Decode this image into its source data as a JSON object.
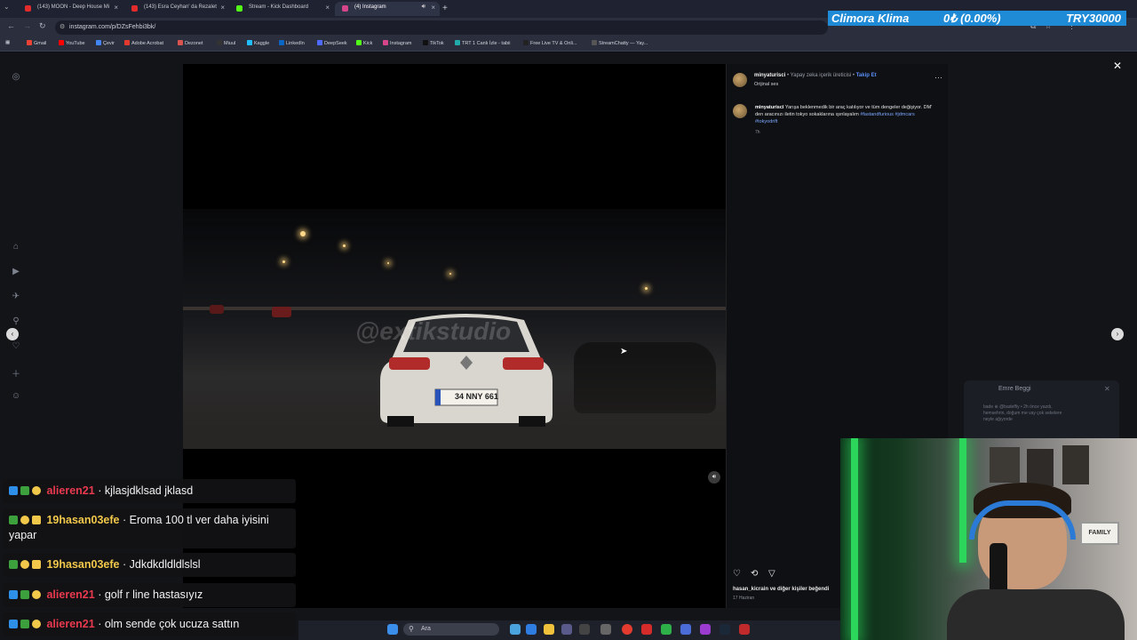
{
  "browser": {
    "tabs": [
      {
        "label": "(143) MOON - Deep House Mi",
        "color": "#e32b2b"
      },
      {
        "label": "(143) Esra Ceyhan' da Rezalet",
        "color": "#e32b2b"
      },
      {
        "label": "Stream - Kick Dashboard",
        "color": "#53fc18"
      },
      {
        "label": "(4) Instagram",
        "color": "#d6458a"
      }
    ],
    "new_tab": "+",
    "url": "instagram.com/p/DZsFehbi3bk/",
    "bookmarks": [
      {
        "label": "Gmail",
        "color": "#ea4335"
      },
      {
        "label": "YouTube",
        "color": "#ff0000"
      },
      {
        "label": "Çevir",
        "color": "#4285f4"
      },
      {
        "label": "Adobe Acrobat",
        "color": "#e23a2e"
      },
      {
        "label": "Dezonet",
        "color": "#d9534f"
      },
      {
        "label": "Miuul",
        "color": "#333"
      },
      {
        "label": "Kaggle",
        "color": "#20beff"
      },
      {
        "label": "LinkedIn",
        "color": "#0a66c2"
      },
      {
        "label": "DeepSeek",
        "color": "#4d6bfe"
      },
      {
        "label": "Kick",
        "color": "#53fc18"
      },
      {
        "label": "Instagram",
        "color": "#d6458a"
      },
      {
        "label": "TikTok",
        "color": "#111"
      },
      {
        "label": "TRT 1 Canlı İzle - tabii",
        "color": "#2aa"
      },
      {
        "label": "Free Live TV & Onli...",
        "color": "#222"
      },
      {
        "label": "StreamChatty — Yay...",
        "color": "#555"
      }
    ]
  },
  "ticker": {
    "name": "Climora Klima",
    "progress": "0₺ (0.00%)",
    "goal": "TRY30000"
  },
  "post": {
    "author": "minyaturisci",
    "author_meta": " • Yapay zeka içerik üreticisi • ",
    "follow": "Takip Et",
    "audio": "Orijinal ses",
    "caption_user": "minyaturisci",
    "caption_text": " Yarışa beklenmedik bir araç katılıyor ve tüm dengeler değişiyor. DM' den aracınızı iletin tokyo sokaklarına ışınlayalım ",
    "caption_tags": "#fastandfurious #jdmcars #tokyodrift",
    "caption_time": "7h",
    "likes": "hasan_kicrain ve diğer kişiler beğendi",
    "date": "17 Haziran",
    "watermark": "@extikstudio",
    "plate": "34 NNY 661"
  },
  "messages": {
    "name": "Emre Beggi",
    "preview": "bade ⊕ @badeffiy • 2h önce yazdı, hemsehrin, doğum me vay çok sekelere neyle ağıyorde"
  },
  "chat": [
    {
      "user": "alieren21",
      "color": "red",
      "text": "· kjlasjdklsad jklasd"
    },
    {
      "user": "19hasan03efe",
      "color": "gold",
      "text": "· Eroma 100 tl ver daha iyisini yapar"
    },
    {
      "user": "19hasan03efe",
      "color": "gold",
      "text": "· Jdkdkdldldlslsl"
    },
    {
      "user": "alieren21",
      "color": "red",
      "text": "· golf r line hastasıyız"
    },
    {
      "user": "alieren21",
      "color": "red",
      "text": "· olm sende çok ucuza sattın"
    }
  ],
  "taskbar": {
    "search": "Ara"
  },
  "webcam": {
    "sign": "FAMILY"
  }
}
